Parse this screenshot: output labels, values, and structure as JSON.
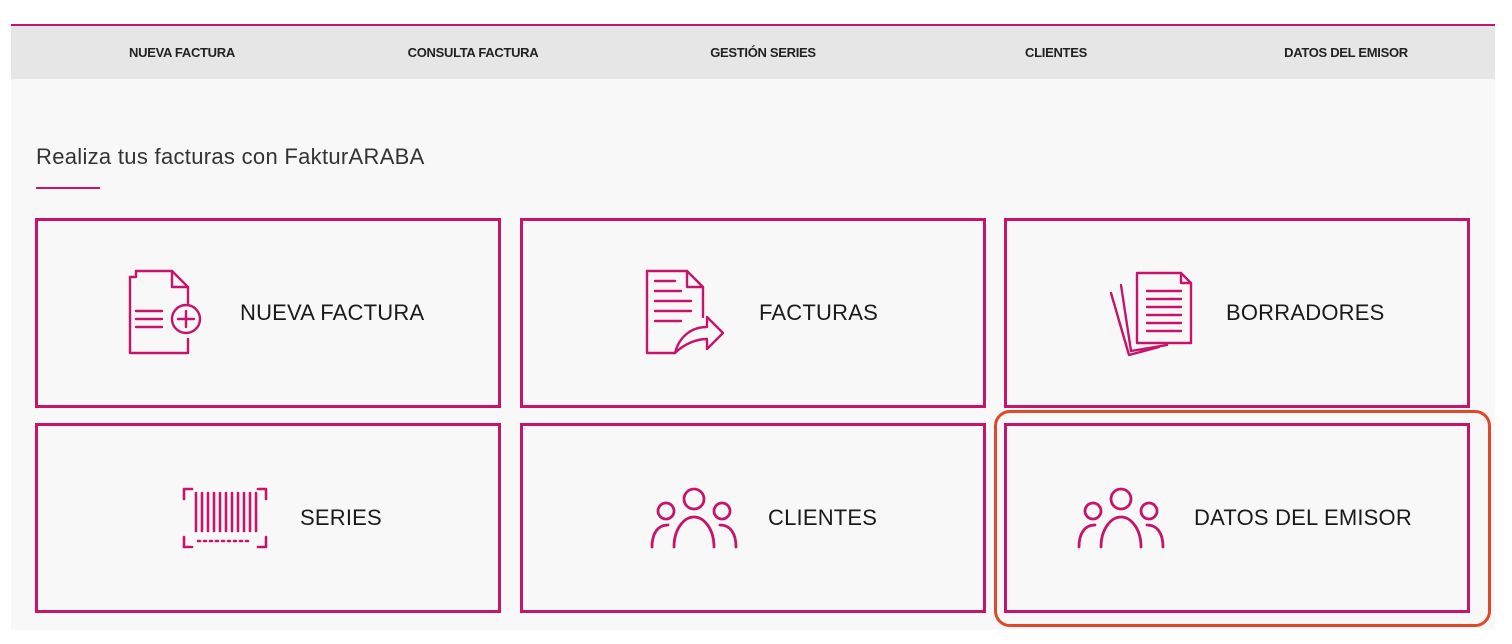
{
  "nav": {
    "items": [
      {
        "label": "NUEVA FACTURA"
      },
      {
        "label": "CONSULTA FACTURA"
      },
      {
        "label": "GESTIÓN SERIES"
      },
      {
        "label": "CLIENTES"
      },
      {
        "label": "DATOS DEL EMISOR"
      }
    ]
  },
  "main": {
    "title": "Realiza tus facturas con FakturARABA",
    "tiles": [
      {
        "label": "NUEVA FACTURA",
        "icon": "new-invoice-icon"
      },
      {
        "label": "FACTURAS",
        "icon": "invoices-icon"
      },
      {
        "label": "BORRADORES",
        "icon": "drafts-icon"
      },
      {
        "label": "SERIES",
        "icon": "barcode-icon"
      },
      {
        "label": "CLIENTES",
        "icon": "clients-icon"
      },
      {
        "label": "DATOS DEL EMISOR",
        "icon": "issuer-icon"
      }
    ]
  },
  "colors": {
    "accent": "#c6146b",
    "nav_bg": "#e6e6e6",
    "page_bg": "#f8f8f8",
    "highlight": "#e0482a"
  }
}
